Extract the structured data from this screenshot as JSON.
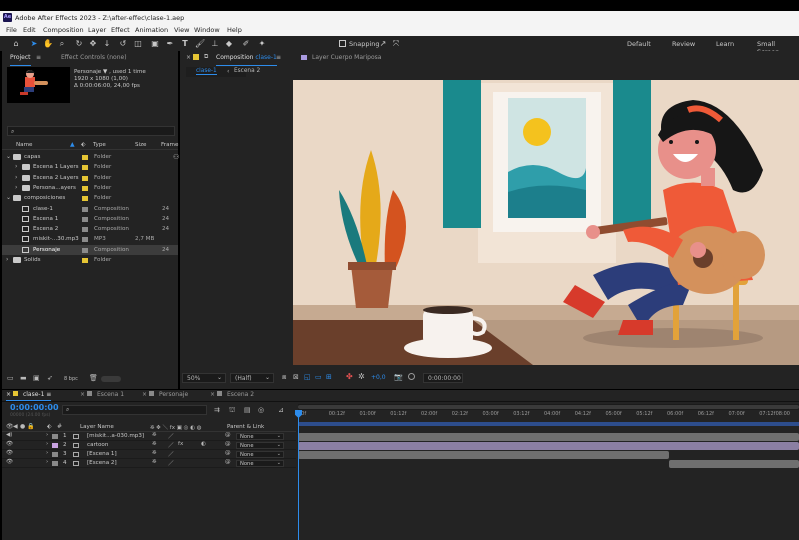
{
  "app": {
    "title": "Adobe After Effects 2023 - Z:\\after-effec\\clase-1.aep",
    "logo_text": "Ae"
  },
  "menu": [
    "File",
    "Edit",
    "Composition",
    "Layer",
    "Effect",
    "Animation",
    "View",
    "Window",
    "Help"
  ],
  "toolbar": {
    "snapping_label": "Snapping",
    "workspaces": [
      "Default",
      "Review",
      "Learn",
      "Small Screen"
    ]
  },
  "project_panel": {
    "tab_project": "Project",
    "tab_effect_controls": "Effect Controls (none)",
    "preview_name": "Personaje ▼ , used 1 time",
    "preview_size": "1920 x 1080 (1,00)",
    "preview_duration": "Δ 0:00:06:00, 24,00 fps",
    "search_icon": "🔎",
    "col_name": "Name",
    "col_type": "Type",
    "col_size": "Size",
    "col_frame": "Frame",
    "rows": [
      {
        "name": "capas",
        "type": "Folder",
        "size": "",
        "frame": "",
        "kind": "folder",
        "indent": 0,
        "open": true,
        "color": "#e5c534"
      },
      {
        "name": "Escena 1 Layers",
        "type": "Folder",
        "size": "",
        "frame": "",
        "kind": "folder",
        "indent": 1,
        "open": false,
        "color": "#e5c534"
      },
      {
        "name": "Escena 2 Layers",
        "type": "Folder",
        "size": "",
        "frame": "",
        "kind": "folder",
        "indent": 1,
        "open": false,
        "color": "#e5c534"
      },
      {
        "name": "Persona...ayers",
        "type": "Folder",
        "size": "",
        "frame": "",
        "kind": "folder",
        "indent": 1,
        "open": false,
        "color": "#e5c534"
      },
      {
        "name": "composiciones",
        "type": "Folder",
        "size": "",
        "frame": "",
        "kind": "folder",
        "indent": 0,
        "open": true,
        "color": "#e5c534"
      },
      {
        "name": "clase-1",
        "type": "Composition",
        "size": "",
        "frame": "24",
        "kind": "comp",
        "indent": 1,
        "open": false,
        "color": "#8a8a8a"
      },
      {
        "name": "Escena 1",
        "type": "Composition",
        "size": "",
        "frame": "24",
        "kind": "comp",
        "indent": 1,
        "open": false,
        "color": "#8a8a8a"
      },
      {
        "name": "Escena 2",
        "type": "Composition",
        "size": "",
        "frame": "24",
        "kind": "comp",
        "indent": 1,
        "open": false,
        "color": "#8a8a8a"
      },
      {
        "name": "miskit-...30.mp3",
        "type": "MP3",
        "size": "2,7 MB",
        "frame": "",
        "kind": "audio",
        "indent": 1,
        "open": false,
        "color": "#8a8a8a"
      },
      {
        "name": "Personaje",
        "type": "Composition",
        "size": "",
        "frame": "24",
        "kind": "comp",
        "indent": 1,
        "open": false,
        "color": "#8a8a8a",
        "selected": true
      },
      {
        "name": "Solids",
        "type": "Folder",
        "size": "",
        "frame": "",
        "kind": "folder",
        "indent": 0,
        "open": false,
        "color": "#e5c534"
      }
    ],
    "bpc": "8 bpc"
  },
  "composition_panel": {
    "tab_label": "Composition",
    "tab_comp": "clase-1",
    "layer_tab": "Layer  Cuerpo Mariposa",
    "subtabs": [
      "clase-1",
      "Escena 2"
    ],
    "zoom": "50%",
    "resolution": "(Half)",
    "exposure": "+0,0",
    "timecode": "0:00:00:00"
  },
  "timeline": {
    "tabs": [
      "clase-1",
      "Escena 1",
      "Personaje",
      "Escena 2"
    ],
    "timecode": "0:00:00:00",
    "timecode_sub": "00000 (24.00 fps)",
    "col_source": "Layer Name",
    "col_parent": "Parent & Link",
    "ruler": [
      "00f",
      "00:12f",
      "01:00f",
      "01:12f",
      "02:00f",
      "02:12f",
      "03:00f",
      "03:12f",
      "04:00f",
      "04:12f",
      "05:00f",
      "05:12f",
      "06:00f",
      "06:12f",
      "07:00f",
      "07:12f",
      "08:00"
    ],
    "layers": [
      {
        "num": "1",
        "name": "[miskit...a-030.mp3]",
        "parent": "None",
        "color": "#8a8a8a"
      },
      {
        "num": "2",
        "name": "cartoon",
        "parent": "None",
        "color": "#c8a2e0"
      },
      {
        "num": "3",
        "name": "[Escena 1]",
        "parent": "None",
        "color": "#8a8a8a"
      },
      {
        "num": "4",
        "name": "[Escena 2]",
        "parent": "None",
        "color": "#8a8a8a"
      }
    ]
  },
  "colors": {
    "accent_blue": "#2d8ceb",
    "folder_yellow": "#e5c534"
  }
}
